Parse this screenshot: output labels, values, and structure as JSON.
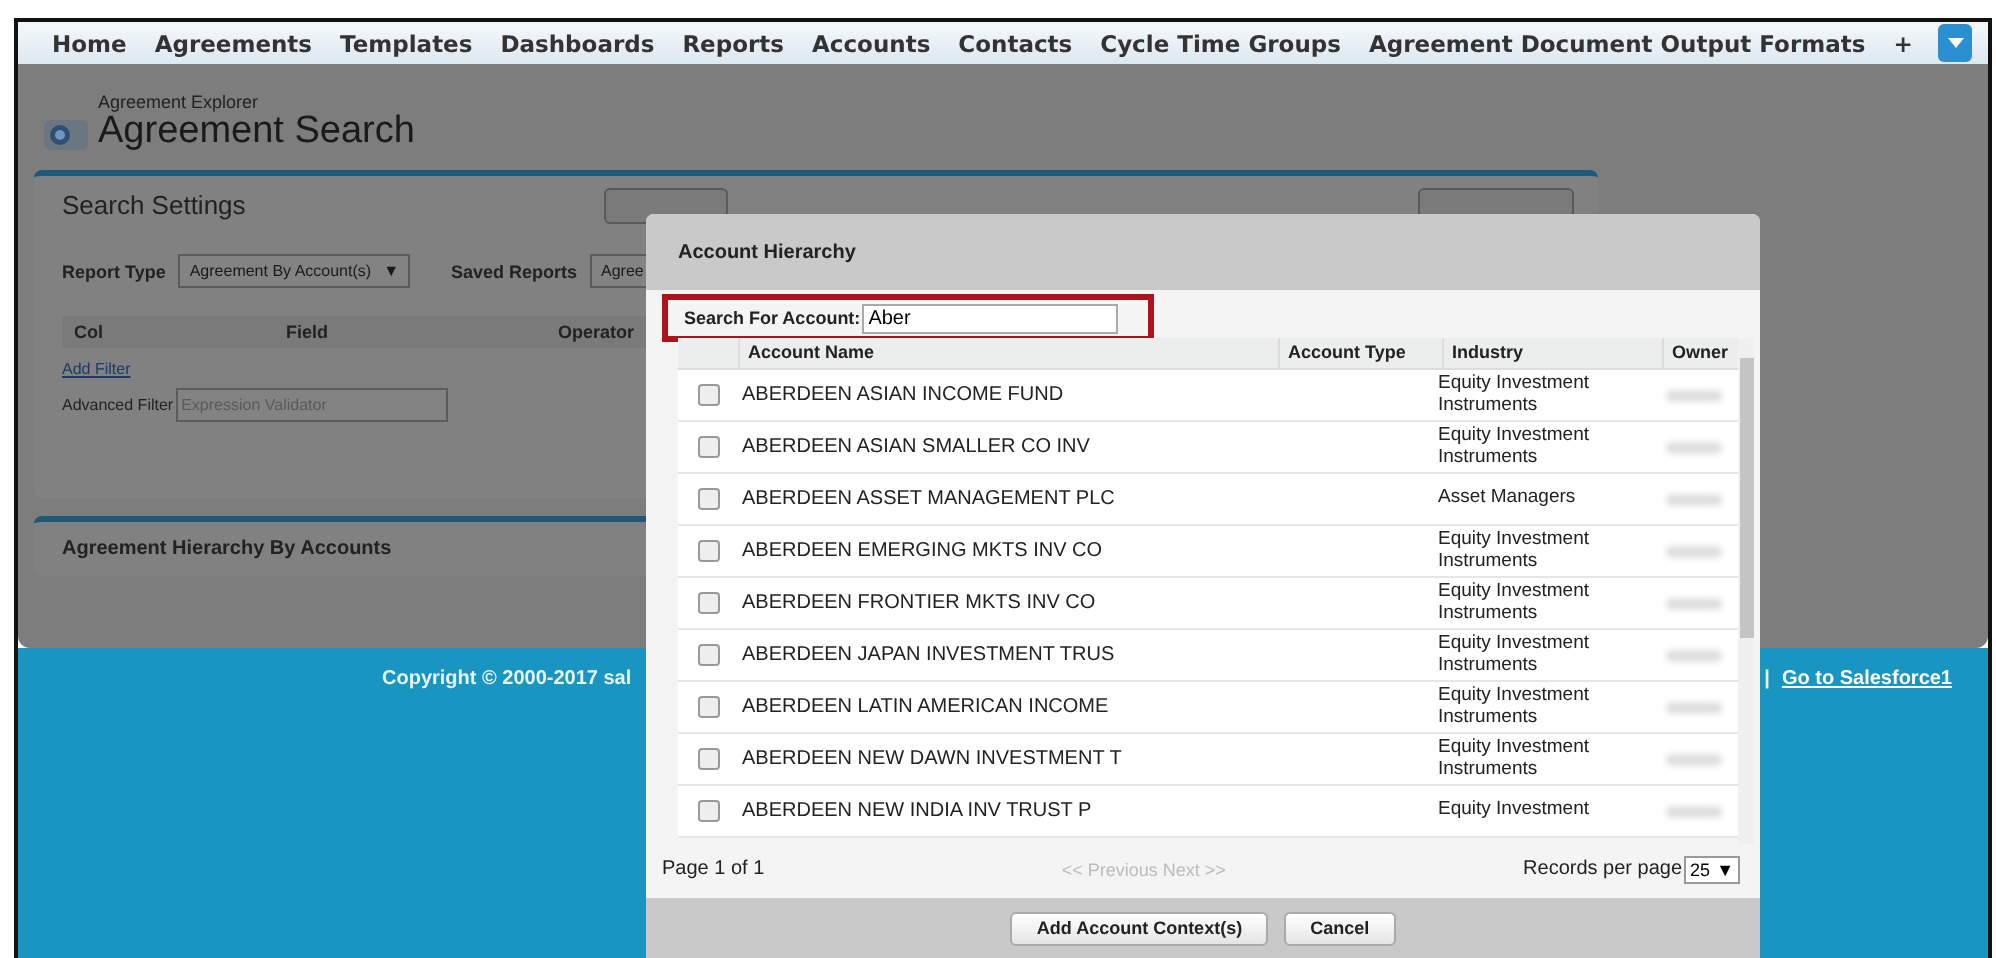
{
  "nav": {
    "items": [
      {
        "label": "Home"
      },
      {
        "label": "Agreements"
      },
      {
        "label": "Templates"
      },
      {
        "label": "Dashboards"
      },
      {
        "label": "Reports"
      },
      {
        "label": "Accounts"
      },
      {
        "label": "Contacts"
      },
      {
        "label": "Cycle Time Groups"
      },
      {
        "label": "Agreement Document Output Formats"
      }
    ],
    "plus": "+"
  },
  "header": {
    "subtitle": "Agreement Explorer",
    "title": "Agreement Search"
  },
  "search_settings": {
    "title": "Search Settings",
    "report_type": {
      "label": "Report Type",
      "value": "Agreement By Account(s)",
      "arrow": "▼"
    },
    "saved_reports": {
      "label": "Saved Reports",
      "value": "Agree"
    },
    "columns": [
      "Col",
      "Field",
      "Operator"
    ],
    "add_filter": "Add Filter",
    "advanced_filter": {
      "label": "Advanced Filter",
      "placeholder": "Expression Validator"
    }
  },
  "hierarchy_panel": {
    "title": "Agreement Hierarchy By Accounts"
  },
  "footer": {
    "copyright": "Copyright © 2000-2017 sal",
    "separator": "|",
    "link": "Go to Salesforce1"
  },
  "modal": {
    "title": "Account Hierarchy",
    "search": {
      "label": "Search For Account:",
      "value": "Aber"
    },
    "columns": [
      "Account Name",
      "Account Type",
      "Industry",
      "Owner"
    ],
    "rows": [
      {
        "name": "ABERDEEN ASIAN INCOME FUND",
        "industry": "Equity Investment Instruments",
        "checked": false
      },
      {
        "name": "ABERDEEN ASIAN SMALLER CO INV",
        "industry": "Equity Investment Instruments",
        "checked": false
      },
      {
        "name": "ABERDEEN ASSET MANAGEMENT PLC",
        "industry": "Asset Managers",
        "checked": false
      },
      {
        "name": "ABERDEEN EMERGING MKTS INV CO",
        "industry": "Equity Investment Instruments",
        "checked": false
      },
      {
        "name": "ABERDEEN FRONTIER MKTS INV CO",
        "industry": "Equity Investment Instruments",
        "checked": false
      },
      {
        "name": "ABERDEEN JAPAN INVESTMENT TRUS",
        "industry": "Equity Investment Instruments",
        "checked": false
      },
      {
        "name": "ABERDEEN LATIN AMERICAN INCOME",
        "industry": "Equity Investment Instruments",
        "checked": false
      },
      {
        "name": "ABERDEEN NEW DAWN INVESTMENT T",
        "industry": "Equity Investment Instruments",
        "checked": false
      },
      {
        "name": "ABERDEEN NEW INDIA INV TRUST P",
        "industry": "Equity Investment",
        "checked": false
      }
    ],
    "pagination": {
      "page": "Page 1 of 1",
      "nav": "<< Previous Next >>",
      "per_page_label": "Records per page",
      "per_page": "25",
      "arrow": "▼"
    },
    "buttons": [
      "Add Account Context(s)",
      "Cancel"
    ]
  }
}
